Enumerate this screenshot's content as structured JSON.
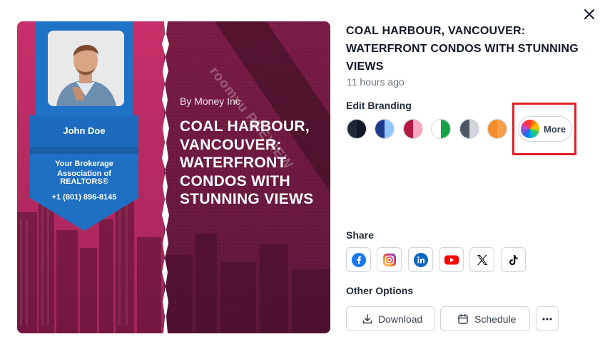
{
  "dialog": {
    "close_icon": "close-icon"
  },
  "preview": {
    "agent_name": "John Doe",
    "brokerage_line1": "Your Brokerage",
    "brokerage_line2": "Association of",
    "brokerage_line3": "REALTORS®",
    "phone": "+1 (801) 896-8145",
    "byline": "By Money Inc",
    "headline": "COAL HARBOUR, VANCOUVER: WATERFRONT CONDOS WITH STUNNING VIEWS",
    "watermark": "roomvu PREVIEW"
  },
  "details": {
    "title": "COAL HARBOUR, VANCOUVER: WATERFRONT CONDOS WITH STUNNING VIEWS",
    "time": "11 hours ago"
  },
  "branding": {
    "label": "Edit Branding",
    "swatches": [
      {
        "left": "#1f2937",
        "right": "#111827"
      },
      {
        "left": "#1e3a8a",
        "right": "#93c5fd"
      },
      {
        "left": "#b31942",
        "right": "#f9a8c0"
      },
      {
        "left": "#ffffff",
        "right": "#16a34a"
      },
      {
        "left": "#4b5563",
        "right": "#d1d5db"
      },
      {
        "left": "#f28c28",
        "right": "#f4a04a"
      }
    ],
    "more_label": "More"
  },
  "share": {
    "label": "Share",
    "buttons": [
      "facebook-icon",
      "instagram-icon",
      "linkedin-icon",
      "youtube-icon",
      "x-icon",
      "tiktok-icon"
    ]
  },
  "options": {
    "label": "Other Options",
    "download_label": "Download",
    "schedule_label": "Schedule",
    "more_icon": "ellipsis-icon"
  },
  "colors": {
    "highlight": "#e01f26",
    "ribbon_blue": "#1c6bbf",
    "preview_pink": "#c7306a",
    "preview_dark": "#6c1a40"
  }
}
